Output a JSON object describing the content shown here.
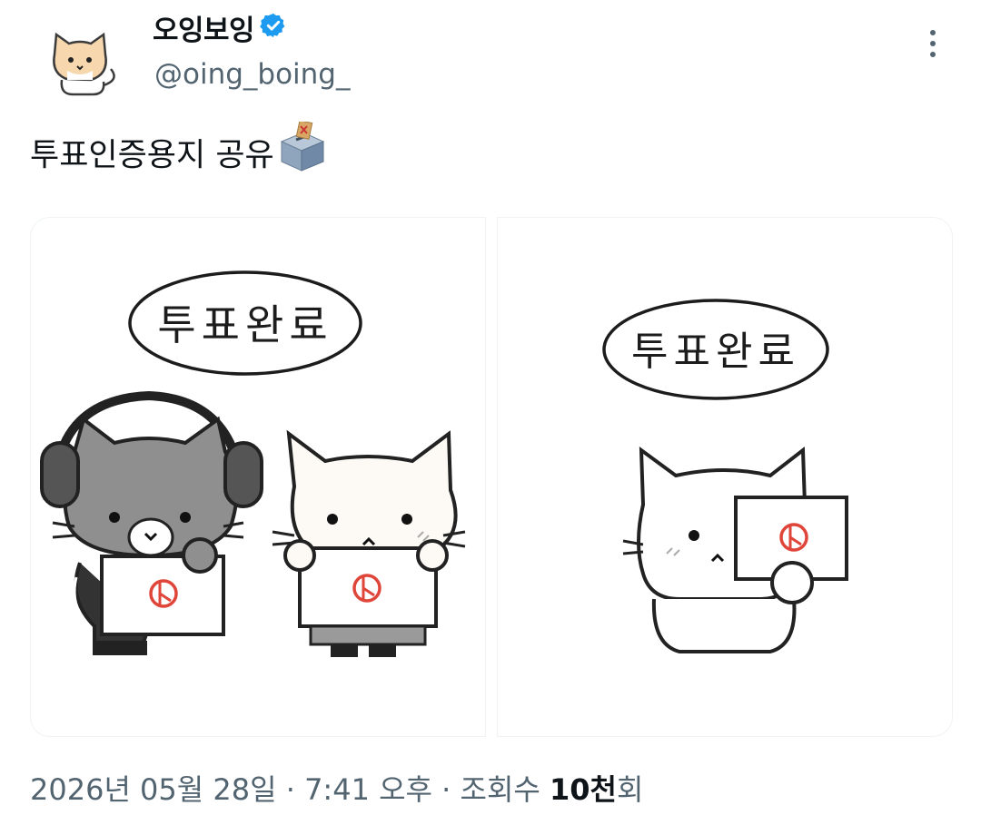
{
  "author": {
    "display_name": "오잉보잉",
    "handle": "@oing_boing_"
  },
  "tweet": {
    "text": "투표인증용지 공유"
  },
  "images": [
    {
      "speech_bubble": "투표완료"
    },
    {
      "speech_bubble": "투표완료"
    }
  ],
  "meta": {
    "date": "2026년 05월 28일",
    "separator1": " · ",
    "time": "7:41 오후",
    "separator2": " · ",
    "views_label": "조회수 ",
    "views_count": "10천",
    "views_suffix": "회"
  },
  "colors": {
    "verified_badge": "#1d9bf0",
    "meta_text": "#536471",
    "stamp_red": "#e0453a"
  },
  "icons": {
    "verified": "verified-badge-icon",
    "more": "more-vertical-icon",
    "emoji": "ballot-box-emoji"
  }
}
